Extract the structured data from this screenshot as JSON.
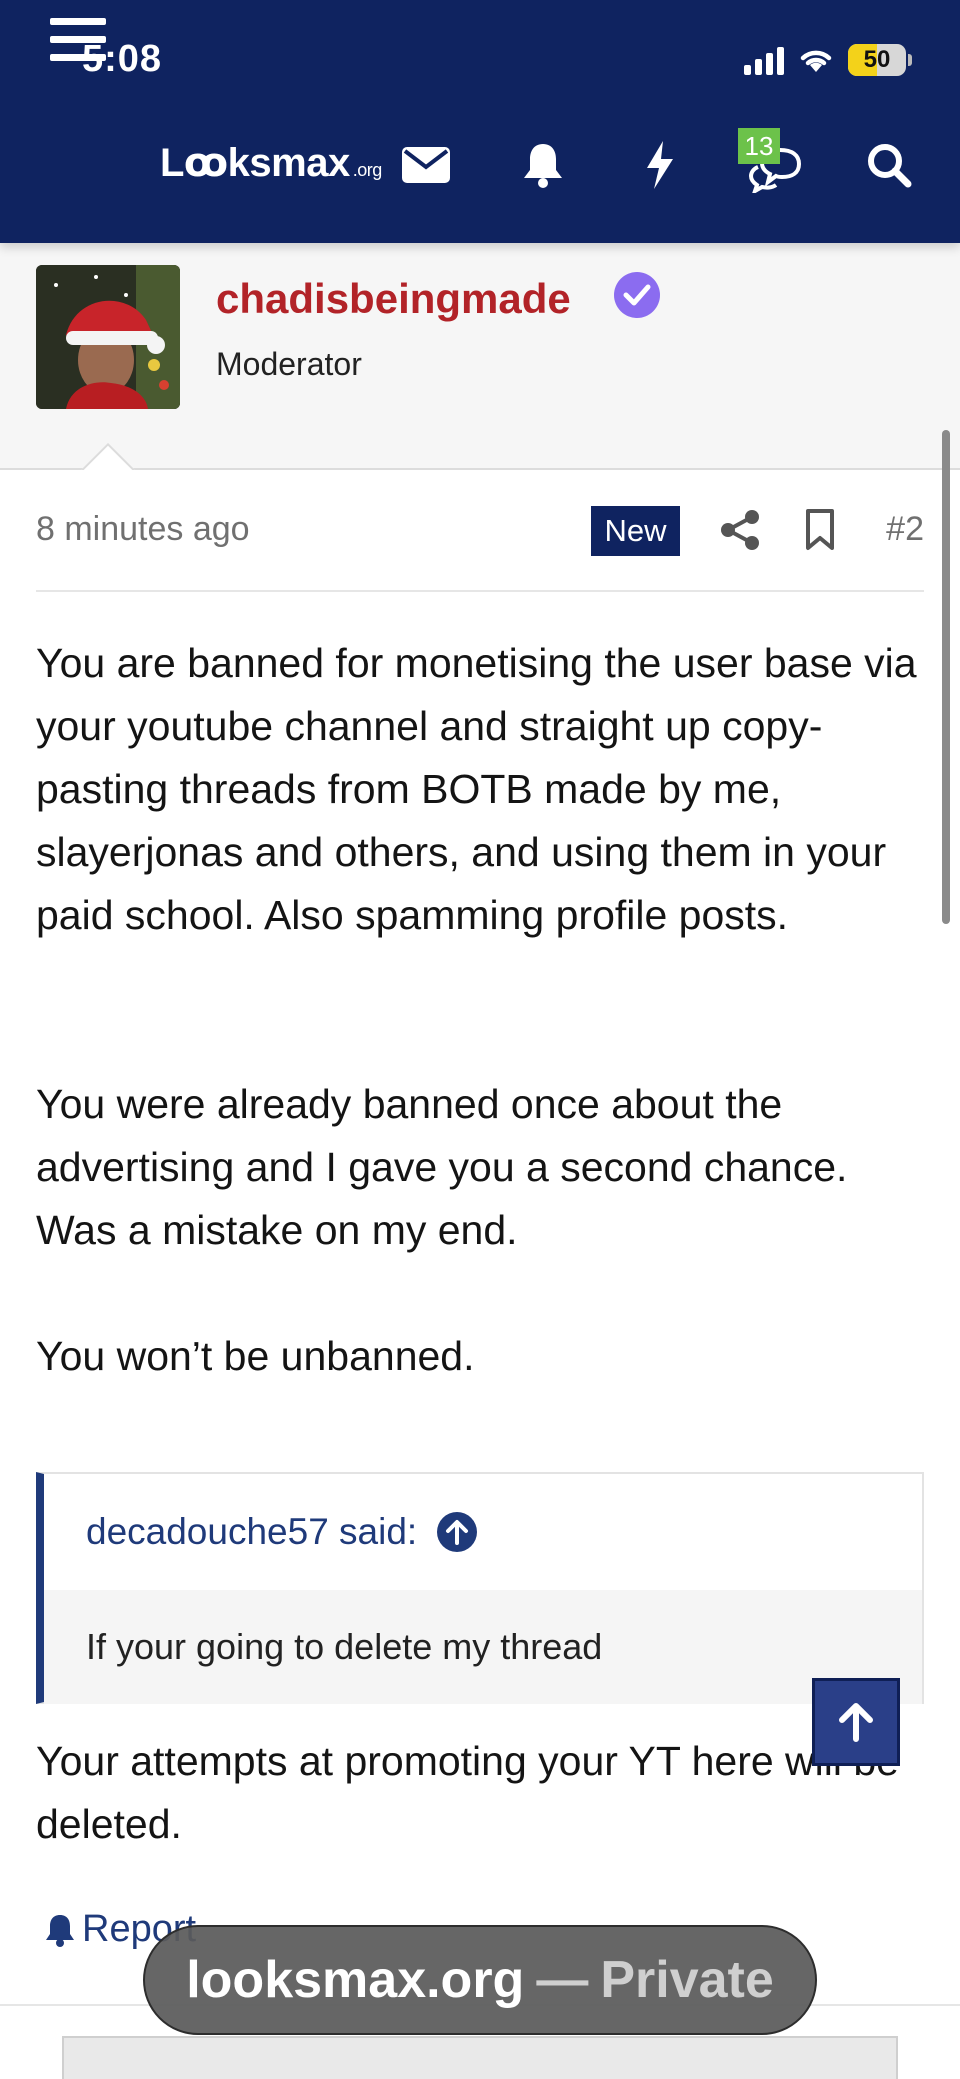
{
  "status_bar": {
    "time": "5:08",
    "battery_percent": "50",
    "battery_level": 0.5
  },
  "nav": {
    "logo_main": "Lꝏksmax",
    "logo_tld": ".org",
    "messages_badge": "13"
  },
  "post": {
    "username": "chadisbeingmade",
    "role": "Moderator",
    "time": "8 minutes ago",
    "new_label": "New",
    "post_number": "#2",
    "paragraphs": [
      "You are banned for monetising the user base via your youtube channel and straight up copy-pasting threads from BOTB made by me, slayerjonas and others, and using them in your paid school. Also spamming profile posts.",
      "You were already banned once about the advertising and I gave you a second chance. Was a mistake on my end.",
      "You won’t be unbanned."
    ],
    "quote": {
      "author": "decadouche57 said:",
      "text": "If your going to delete my thread"
    },
    "after_quote": "Your attempts at promoting your YT here will be deleted.",
    "report_label": "Report"
  },
  "browser": {
    "host": "looksmax.org",
    "separator": "—",
    "mode": "Private"
  },
  "colors": {
    "nav_bg": "#0f2360",
    "username": "#b22328",
    "accent": "#1f3a7a",
    "badge_green": "#6cc24a",
    "verified": "#8b6cf0"
  }
}
